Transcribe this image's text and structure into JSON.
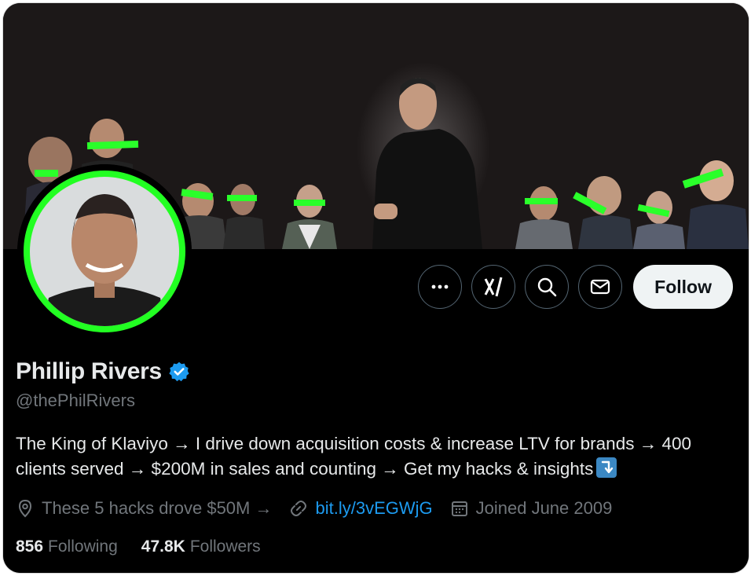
{
  "profile": {
    "name": "Phillip Rivers",
    "handle": "@thePhilRivers",
    "bio": "The King of Klaviyo → I drive down acquisition costs & increase LTV for brands → 400 clients served → $200M in sales and counting  → Get my hacks & insights",
    "location": "These 5 hacks drove $50M →",
    "website": "bit.ly/3vEGWjG",
    "joined": "Joined June 2009",
    "verified": true
  },
  "stats": {
    "following_count": "856",
    "following_label": "Following",
    "followers_count": "47.8K",
    "followers_label": "Followers"
  },
  "actions": {
    "follow_label": "Follow",
    "more_icon": "more-icon",
    "grok_icon": "grok-icon",
    "search_icon": "search-icon",
    "message_icon": "message-icon"
  },
  "colors": {
    "background": "#000000",
    "accent": "#1d9bf0",
    "avatar_ring": "#22ff22",
    "verified": "#1d9bf0",
    "follow_button": "#eff3f4"
  }
}
